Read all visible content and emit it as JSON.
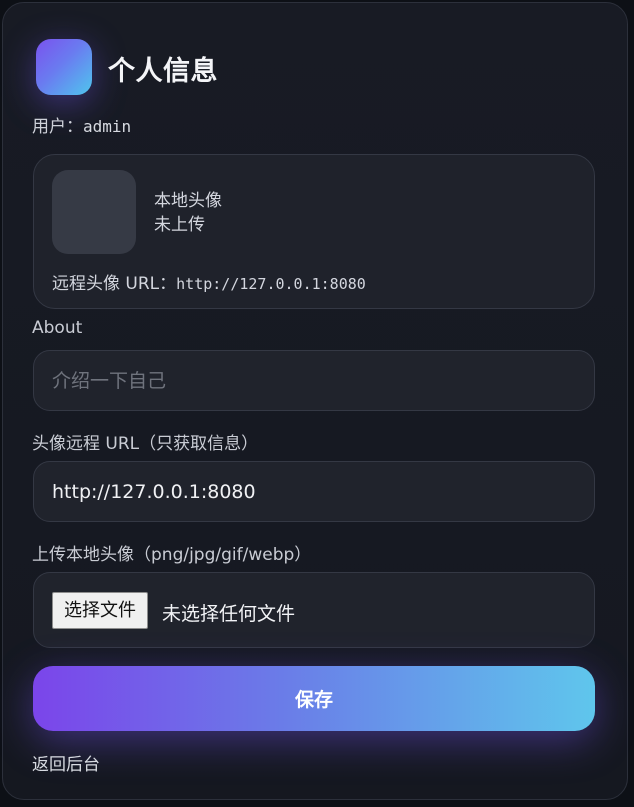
{
  "header": {
    "title": "个人信息"
  },
  "user": {
    "label": "用户：",
    "value": "admin"
  },
  "avatar_panel": {
    "local_label": "本地头像",
    "local_status": "未上传",
    "remote_label": "远程头像 URL：",
    "remote_value": "http://127.0.0.1:8080"
  },
  "about": {
    "label": "About",
    "placeholder": "介绍一下自己",
    "value": ""
  },
  "remote_url": {
    "label": "头像远程 URL（只获取信息）",
    "value": "http://127.0.0.1:8080"
  },
  "upload": {
    "label": "上传本地头像（png/jpg/gif/webp）",
    "button_label": "选择文件",
    "status": "未选择任何文件"
  },
  "actions": {
    "save_label": "保存",
    "back_label": "返回后台"
  },
  "colors": {
    "accent_start": "#7b45ea",
    "accent_end": "#5fc6ec",
    "background": "#0d1016",
    "card": "#181b24"
  }
}
